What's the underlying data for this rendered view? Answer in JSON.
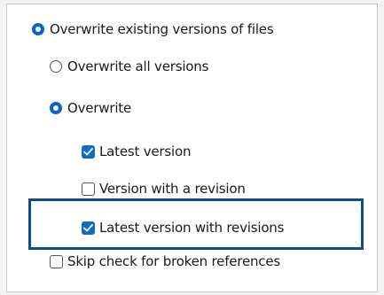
{
  "options": {
    "overwrite_existing": {
      "label": "Overwrite existing versions of files",
      "checked": true
    },
    "overwrite_all": {
      "label": "Overwrite all versions",
      "checked": false
    },
    "overwrite": {
      "label": "Overwrite",
      "checked": true
    },
    "latest_version": {
      "label": "Latest version",
      "checked": true
    },
    "version_with_revision": {
      "label": "Version with a revision",
      "checked": false
    },
    "latest_with_revisions": {
      "label": "Latest version with revisions",
      "checked": true
    },
    "skip_broken_refs": {
      "label": "Skip check for broken references",
      "checked": false
    }
  },
  "colors": {
    "accent": "#0b63c9",
    "highlight_border": "#0d4f83"
  }
}
